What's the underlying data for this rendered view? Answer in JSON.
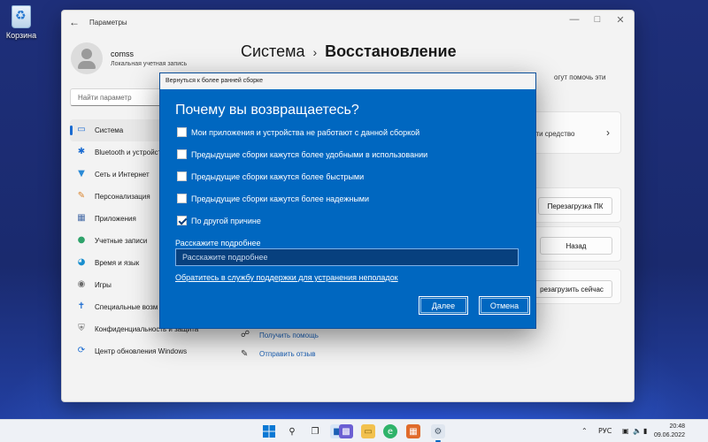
{
  "desktop": {
    "recycle_bin_label": "Корзина"
  },
  "settings_window": {
    "title": "Параметры",
    "account": {
      "name": "comss",
      "type": "Локальная учетная запись"
    },
    "search_placeholder": "Найти параметр",
    "nav_items": [
      {
        "label": "Система",
        "icon": "monitor-icon",
        "color": "#1a6bd1"
      },
      {
        "label": "Bluetooth и устройства",
        "icon": "bluetooth-icon",
        "color": "#1a6bd1"
      },
      {
        "label": "Сеть и Интернет",
        "icon": "wifi-icon",
        "color": "#2a8ad6"
      },
      {
        "label": "Персонализация",
        "icon": "brush-icon",
        "color": "#d9822b"
      },
      {
        "label": "Приложения",
        "icon": "apps-icon",
        "color": "#4a6ea8"
      },
      {
        "label": "Учетные записи",
        "icon": "person-icon",
        "color": "#2fa36b"
      },
      {
        "label": "Время и язык",
        "icon": "globe-icon",
        "color": "#1a8fcf"
      },
      {
        "label": "Игры",
        "icon": "gamepad-icon",
        "color": "#6a6a6a"
      },
      {
        "label": "Специальные возм",
        "icon": "accessibility-icon",
        "color": "#1a6bd1"
      },
      {
        "label": "Конфиденциальность и защита",
        "icon": "shield-icon",
        "color": "#6a6a6a"
      },
      {
        "label": "Центр обновления Windows",
        "icon": "update-icon",
        "color": "#1a6bd1"
      }
    ],
    "breadcrumb": {
      "parent": "Система",
      "separator": "›",
      "current": "Восстановление"
    },
    "fragments": {
      "top_right": "огут помочь эти",
      "card_text": "ости средство",
      "restart_pc": "Перезагрузка ПК",
      "back": "Назад",
      "restart_now": "резагрузить сейчас"
    },
    "help": {
      "get_help": "Получить помощь",
      "send_feedback": "Отправить отзыв"
    }
  },
  "dialog": {
    "title": "Вернуться к более ранней сборке",
    "heading": "Почему вы возвращаетесь?",
    "options": [
      {
        "label": "Мои приложения и устройства не работают с данной сборкой",
        "checked": false
      },
      {
        "label": "Предыдущие сборки кажутся более удобными в использовании",
        "checked": false
      },
      {
        "label": "Предыдущие сборки кажутся более быстрыми",
        "checked": false
      },
      {
        "label": "Предыдущие сборки кажутся более надежными",
        "checked": false
      },
      {
        "label": "По другой причине",
        "checked": true
      }
    ],
    "details_label": "Расскажите подробнее",
    "details_placeholder": "Расскажите подробнее",
    "support_link": "Обратитесь в службу поддержки для устранения неполадок",
    "next_button": "Далее",
    "cancel_button": "Отмена",
    "accent_color": "#0067c0"
  },
  "taskbar": {
    "language": "РУС",
    "time": "20:48",
    "date": "09.06.2022"
  }
}
